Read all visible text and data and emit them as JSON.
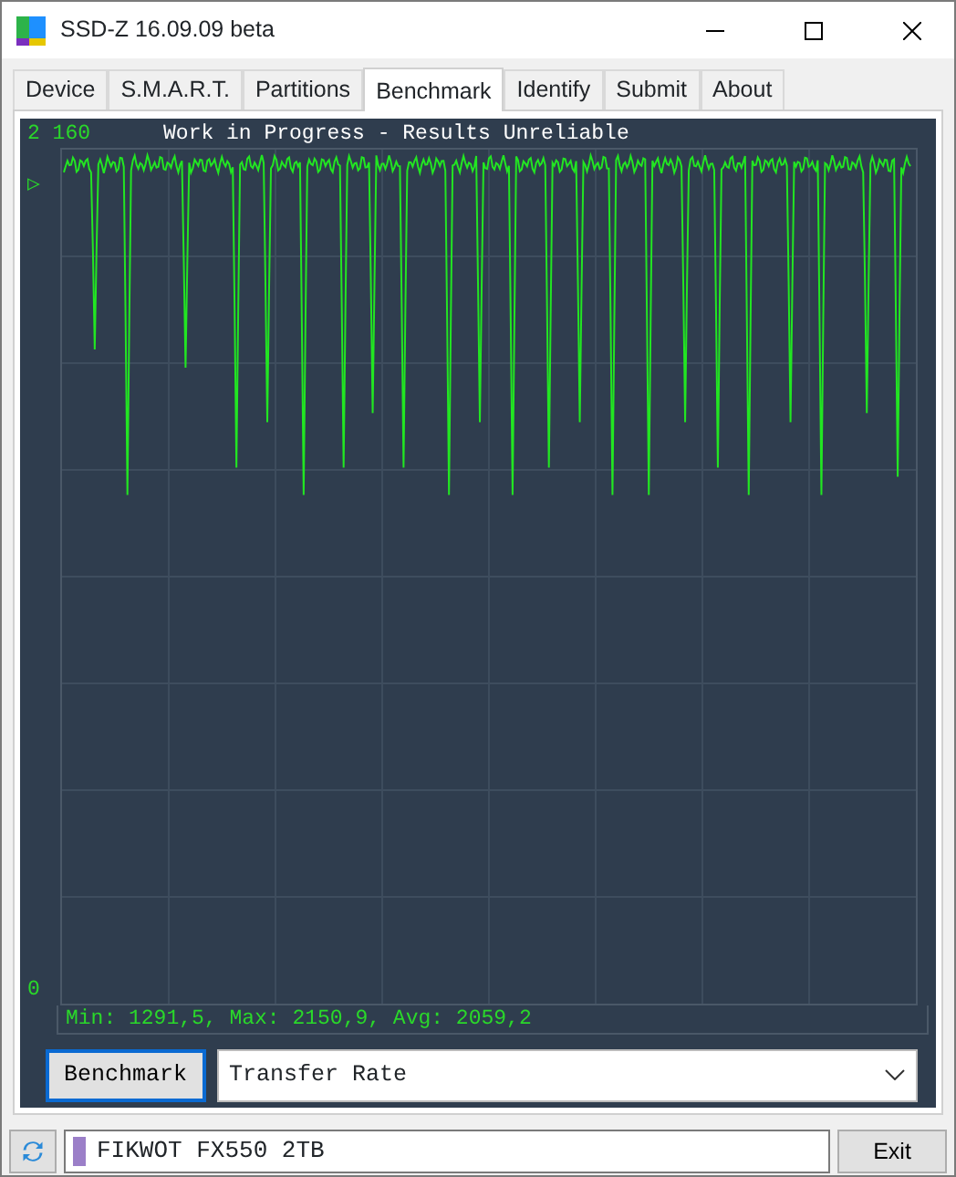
{
  "window": {
    "title": "SSD-Z 16.09.09 beta"
  },
  "tabs": [
    {
      "label": "Device",
      "selected": false
    },
    {
      "label": "S.M.A.R.T.",
      "selected": false
    },
    {
      "label": "Partitions",
      "selected": false
    },
    {
      "label": "Benchmark",
      "selected": true
    },
    {
      "label": "Identify",
      "selected": false
    },
    {
      "label": "Submit",
      "selected": false
    },
    {
      "label": "About",
      "selected": false
    }
  ],
  "graph": {
    "top_label": "2 160",
    "bottom_label": "0",
    "marker": "▷",
    "title": "Work in Progress - Results Unreliable",
    "stats": "Min: 1291,5, Max: 2150,9, Avg: 2059,2"
  },
  "controls": {
    "button": "Benchmark",
    "mode": "Transfer Rate"
  },
  "status_bar": {
    "drive": "FIKWOT FX550 2TB",
    "exit": "Exit"
  }
}
